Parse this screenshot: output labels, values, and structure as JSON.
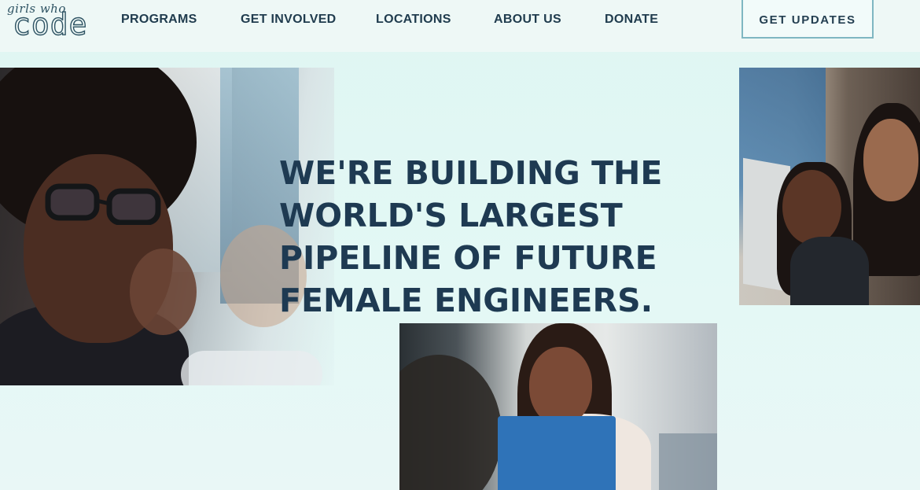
{
  "logo": {
    "line1": "girls who",
    "line2": "code"
  },
  "nav": {
    "items": [
      {
        "label": "PROGRAMS"
      },
      {
        "label": "GET INVOLVED"
      },
      {
        "label": "LOCATIONS"
      },
      {
        "label": "ABOUT US"
      },
      {
        "label": "DONATE"
      }
    ],
    "cta_label": "GET  UPDATES"
  },
  "hero": {
    "headline_lines": [
      "WE'RE BUILDING THE",
      "WORLD'S LARGEST",
      "PIPELINE OF FUTURE",
      "FEMALE ENGINEERS."
    ]
  },
  "colors": {
    "headline": "#1e3a52",
    "nav_text": "#203c4e",
    "background": "#e3f8f5",
    "button_border": "#7fb7c2"
  }
}
